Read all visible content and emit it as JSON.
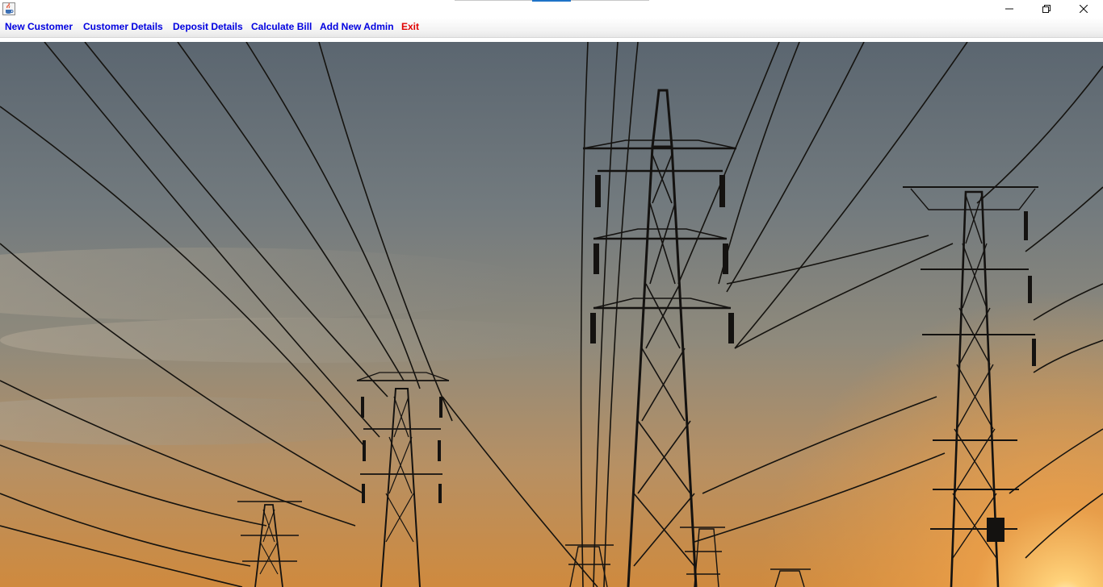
{
  "window": {
    "app_icon": "java-cup-icon",
    "controls": [
      "minimize-icon",
      "restore-icon",
      "close-icon"
    ],
    "accent_color": "#1e73c8"
  },
  "menu": {
    "items": [
      {
        "label": "New Customer",
        "color": "#0000e0"
      },
      {
        "label": "Customer Details",
        "color": "#0000e0"
      },
      {
        "label": "Deposit Details",
        "color": "#0000e0"
      },
      {
        "label": "Calculate Bill",
        "color": "#0000e0"
      },
      {
        "label": "Add New Admin",
        "color": "#0000e0"
      },
      {
        "label": "Exit",
        "color": "#e00000"
      }
    ]
  },
  "background": {
    "subject": "electricity transmission towers at sunset",
    "sky_top": "#5d6873",
    "sky_bottom": "#e89a3c"
  }
}
